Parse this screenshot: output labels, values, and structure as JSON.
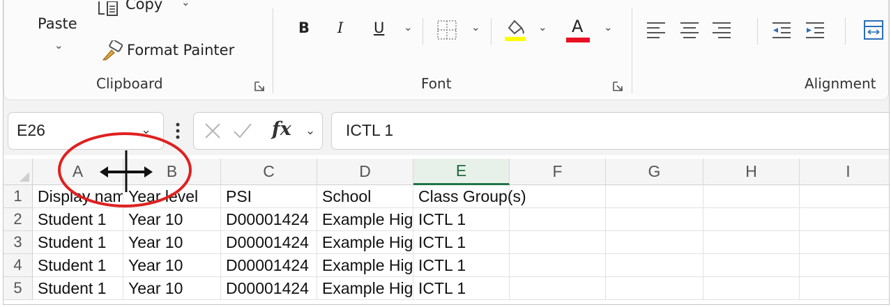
{
  "clipboard": {
    "paste_label": "Paste",
    "copy_label": "Copy",
    "format_painter_label": "Format Painter",
    "group_label": "Clipboard"
  },
  "font": {
    "bold_label": "B",
    "italic_label": "I",
    "underline_label": "U",
    "group_label": "Font",
    "highlight_color": "#ffff00",
    "font_color": "#e81123"
  },
  "alignment": {
    "group_label": "Alignment"
  },
  "formula_bar": {
    "name_box_value": "E26",
    "fx_label": "fx",
    "formula_value": "ICTL 1"
  },
  "columns": [
    "A",
    "B",
    "C",
    "D",
    "E",
    "F",
    "G",
    "H",
    "I"
  ],
  "active_column": "E",
  "rows": [
    {
      "num": "1",
      "cells": [
        "Display name",
        "Year level",
        "PSI",
        "School",
        "Class Group(s)",
        "",
        "",
        "",
        ""
      ]
    },
    {
      "num": "2",
      "cells": [
        "Student 1",
        "Year 10",
        "D00001424",
        "Example High",
        "ICTL 1",
        "",
        "",
        "",
        ""
      ]
    },
    {
      "num": "3",
      "cells": [
        "Student 1",
        "Year 10",
        "D00001424",
        "Example High",
        "ICTL 1",
        "",
        "",
        "",
        ""
      ]
    },
    {
      "num": "4",
      "cells": [
        "Student 1",
        "Year 10",
        "D00001424",
        "Example High",
        "ICTL 1",
        "",
        "",
        "",
        ""
      ]
    },
    {
      "num": "5",
      "cells": [
        "Student 1",
        "Year 10",
        "D00001424",
        "Example High",
        "ICTL 1",
        "",
        "",
        "",
        ""
      ]
    }
  ],
  "annotation": {
    "circle_color": "#e02020",
    "cursor_icon": "column-resize-cursor-icon"
  }
}
